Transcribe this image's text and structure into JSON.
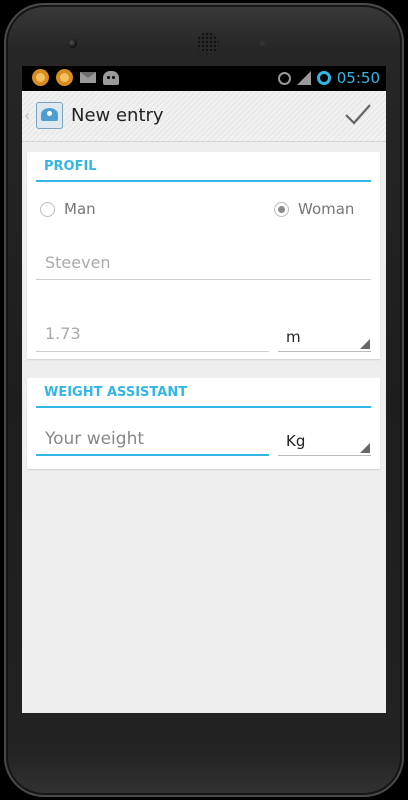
{
  "status_bar": {
    "time": "05:50",
    "icons": [
      "notification-icon",
      "notification-icon",
      "mail-icon",
      "android-icon",
      "alarm-icon",
      "signal-icon",
      "sync-ring-icon"
    ]
  },
  "action_bar": {
    "title": "New entry",
    "confirm_icon": "checkmark-icon"
  },
  "profil": {
    "title": "PROFIL",
    "gender_options": [
      "Man",
      "Woman"
    ],
    "selected_gender": "Woman",
    "name_value": "Steeven",
    "height_value": "1.73",
    "height_unit": "m"
  },
  "weight_assistant": {
    "title": "WEIGHT ASSISTANT",
    "weight_placeholder": "Your weight",
    "weight_unit": "Kg"
  },
  "colors": {
    "accent": "#33b5e5",
    "background": "#eeeeee",
    "card": "#ffffff"
  }
}
